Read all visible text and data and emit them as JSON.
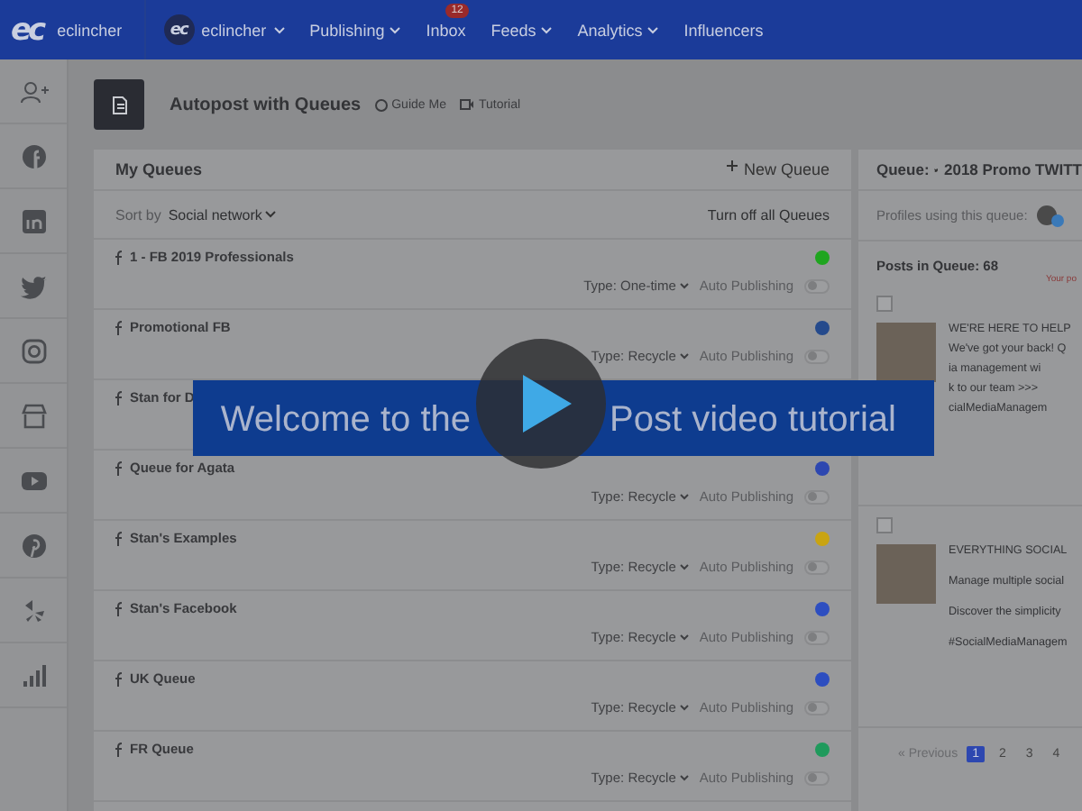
{
  "nav": {
    "logo": "ec",
    "brand": "eclincher",
    "account_logo": "ec",
    "account": "eclincher",
    "menu": [
      {
        "label": "Publishing",
        "caret": true
      },
      {
        "label": "Inbox",
        "caret": false,
        "badge": "12"
      },
      {
        "label": "Feeds",
        "caret": true
      },
      {
        "label": "Analytics",
        "caret": true
      },
      {
        "label": "Influencers",
        "caret": false
      }
    ]
  },
  "page": {
    "title": "Autopost with Queues",
    "guide": "Guide Me",
    "tutorial": "Tutorial"
  },
  "queues": {
    "title": "My Queues",
    "new_queue": "New Queue",
    "sort_label": "Sort by",
    "sort_value": "Social network",
    "turn_off": "Turn off all Queues",
    "items": [
      {
        "name": "1 - FB 2019 Professionals",
        "color": "#1fa51f",
        "type": "Type: One-time",
        "auto": "Auto Publishing",
        "on": false
      },
      {
        "name": "Promotional FB",
        "color": "#254a8c",
        "type": "Type: Recycle",
        "auto": "Auto Publishing",
        "on": false
      },
      {
        "name": "Stan for D"
      },
      {
        "name": "Queue for Agata",
        "color": "#2d47b0",
        "type": "Type: Recycle",
        "auto": "Auto Publishing",
        "on": false
      },
      {
        "name": "Stan's Examples",
        "color": "#c9a412",
        "type": "Type: Recycle",
        "auto": "Auto Publishing",
        "on": false
      },
      {
        "name": "Stan's Facebook",
        "color": "#2d4ec0",
        "type": "Type: Recycle",
        "auto": "Auto Publishing",
        "on": false
      },
      {
        "name": "UK Queue",
        "color": "#2d4ec0",
        "type": "Type: Recycle",
        "auto": "Auto Publishing",
        "on": false
      },
      {
        "name": "FR Queue",
        "color": "#1f9a5c",
        "type": "Type: Recycle",
        "auto": "Auto Publishing",
        "on": false
      }
    ]
  },
  "queue_panel": {
    "label": "Queue:",
    "name": "2018 Promo TWITT",
    "profiles": "Profiles using this queue:",
    "posts_count": "Posts in Queue: 68",
    "notice": "Your po",
    "posts": [
      {
        "checked": false,
        "lines": [
          "WE'RE HERE TO HELP",
          "We've got your back! Q",
          "ia management wi",
          "k to our team >>>",
          "cialMediaManagem"
        ]
      },
      {
        "checked": false,
        "lines": [
          "EVERYTHING SOCIAL",
          "Manage multiple social",
          "Discover the simplicity",
          "#SocialMediaManagem"
        ]
      }
    ],
    "pagination": {
      "previous": "« Previous",
      "pages": [
        {
          "label": "1",
          "selected": true
        },
        {
          "label": "2",
          "selected": false
        },
        {
          "label": "3",
          "selected": false
        },
        {
          "label": "4",
          "selected": false
        }
      ]
    }
  },
  "video": {
    "caption_before": "Welcome to the",
    "caption_after": "Post video tutorial"
  }
}
